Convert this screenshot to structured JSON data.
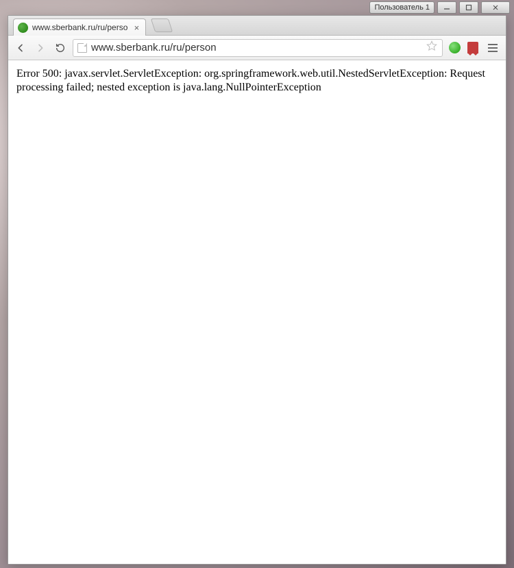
{
  "window": {
    "user_badge": "Пользователь 1"
  },
  "tab": {
    "title": "www.sberbank.ru/ru/perso"
  },
  "address_bar": {
    "url": "www.sberbank.ru/ru/person"
  },
  "page": {
    "error_text": "Error 500: javax.servlet.ServletException: org.springframework.web.util.NestedServletException: Request processing failed; nested exception is java.lang.NullPointerException"
  }
}
